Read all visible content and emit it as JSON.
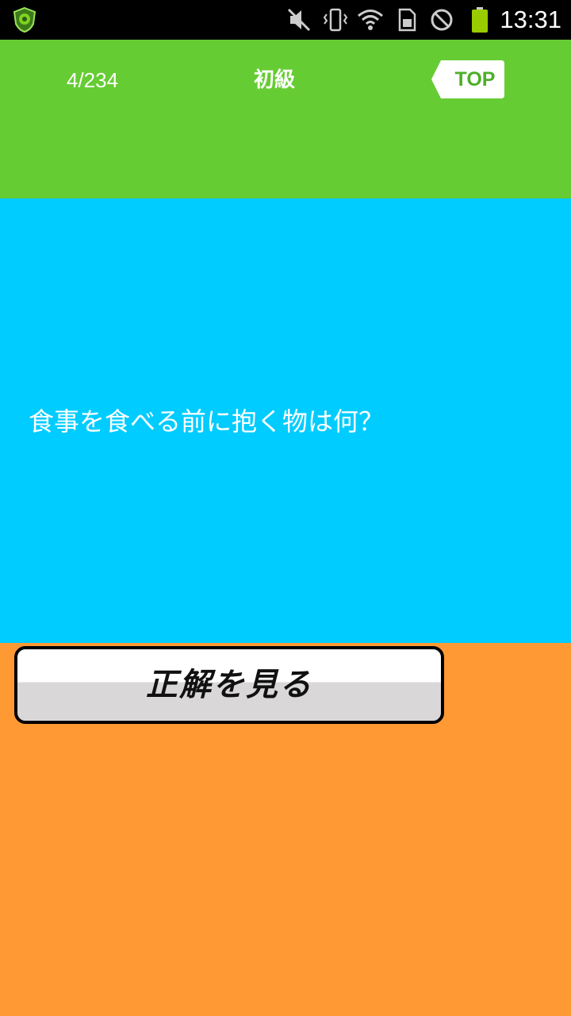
{
  "status_bar": {
    "time": "13:31",
    "icons": [
      "app-shield-icon",
      "mute-icon",
      "vibrate-icon",
      "wifi-icon",
      "sim-icon",
      "no-signal-icon",
      "battery-icon"
    ]
  },
  "header": {
    "progress": "4/234",
    "level": "初級",
    "top_button_label": "TOP",
    "background_color": "#66cc33"
  },
  "question": {
    "text": "食事を食べる前に抱く物は何？",
    "background_color": "#00ccff"
  },
  "answer": {
    "button_label": "正解を見る",
    "background_color": "#ff9933"
  }
}
